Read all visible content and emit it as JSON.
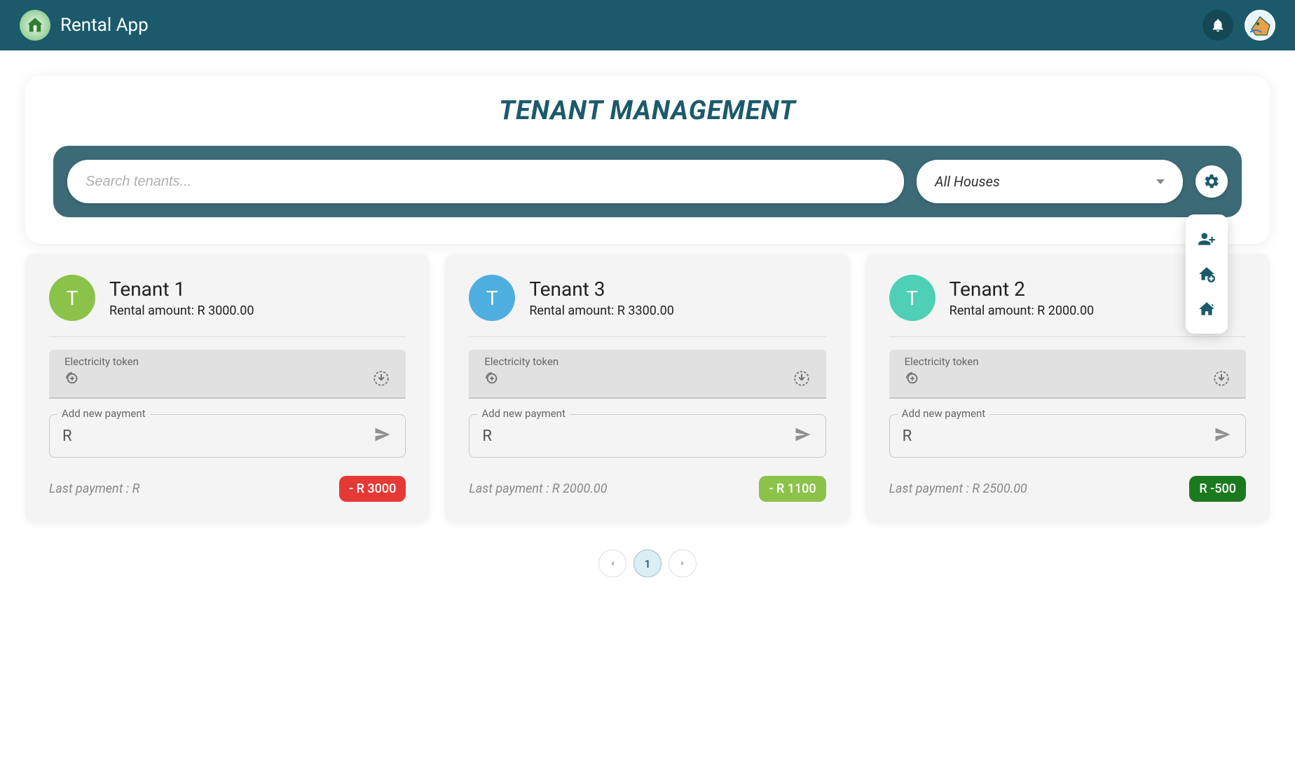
{
  "header": {
    "brand": "Rental App"
  },
  "banner": {
    "title": "TENANT MANAGEMENT",
    "search_placeholder": "Search tenants...",
    "house_select": "All Houses"
  },
  "fab": {
    "add_user": "add-user",
    "add_house": "add-house",
    "house_settings": "house-settings"
  },
  "card_common": {
    "rental_label": "Rental amount: R ",
    "token_label": "Electricity token",
    "payment_label": "Add new payment",
    "payment_prefix": "R",
    "last_pay_label": "Last payment : R "
  },
  "tenants": [
    {
      "initial": "T",
      "name": "Tenant 1",
      "rental": "3000.00",
      "avatar_color": "#8bc34a",
      "last_payment": "",
      "chip_text": "- R 3000",
      "chip_color": "#e53935"
    },
    {
      "initial": "T",
      "name": "Tenant 3",
      "rental": "3300.00",
      "avatar_color": "#4faee0",
      "last_payment": "2000.00",
      "chip_text": "- R 1100",
      "chip_color": "#8bc34a"
    },
    {
      "initial": "T",
      "name": "Tenant 2",
      "rental": "2000.00",
      "avatar_color": "#4dd0b5",
      "last_payment": "2500.00",
      "chip_text": "R -500",
      "chip_color": "#1b7a1f"
    }
  ],
  "pagination": {
    "current": "1"
  }
}
